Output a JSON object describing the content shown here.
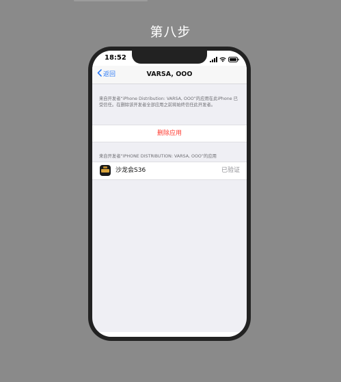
{
  "page": {
    "step_title": "第八步"
  },
  "statusbar": {
    "time": "18:52"
  },
  "navbar": {
    "back_label": "返回",
    "title": "VARSA, OOO"
  },
  "trust": {
    "description": "来自开发者“iPhone Distribution: VARSA, OOO”的应用在此iPhone 已受信任。在删除该开发者全部应用之前将始终信任此开发者。",
    "delete_label": "删除应用",
    "section_header": "来自开发者“IPHONE DISTRIBUTION: VARSA, OOO”的应用",
    "apps": [
      {
        "name": "沙龙会S36",
        "status": "已验证"
      }
    ]
  },
  "colors": {
    "background": "#8a8a8a",
    "link_blue": "#2f7cf6",
    "destructive_red": "#ff3b30",
    "secondary_gray": "#8e8e93"
  },
  "icons": {
    "back": "chevron-left-icon",
    "signal": "cellular-signal-icon",
    "wifi": "wifi-icon",
    "battery": "battery-icon",
    "app": "app-icon"
  }
}
